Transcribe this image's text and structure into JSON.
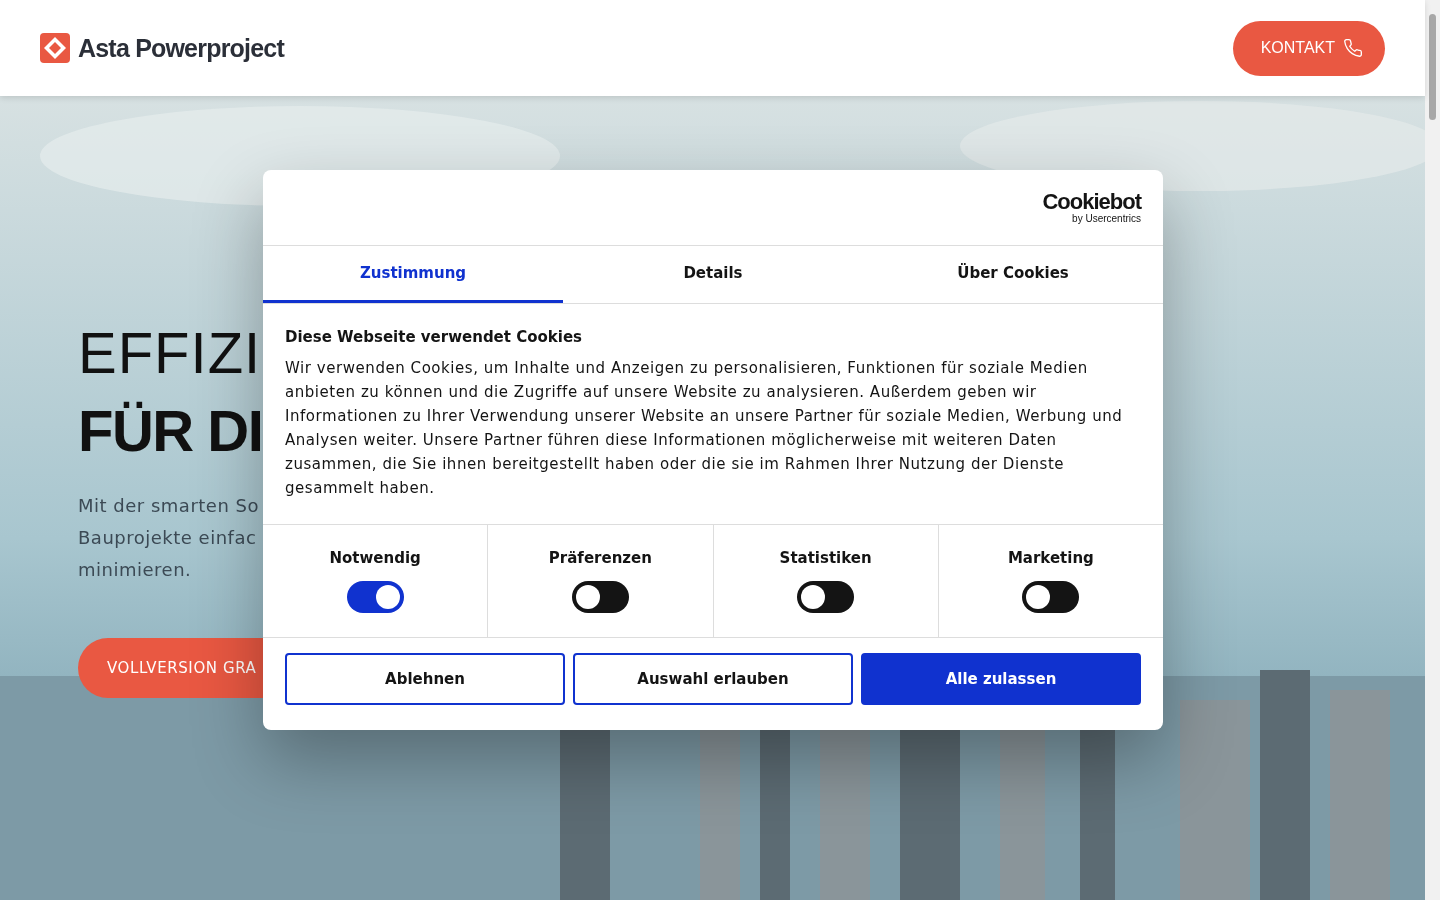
{
  "header": {
    "logo": "Asta Powerproject",
    "contact_button": "KONTAKT"
  },
  "hero": {
    "title_lines": [
      "EFFIZI",
      "FÜR DI"
    ],
    "text_lines": [
      "Mit der smarten So",
      "Bauprojekte einfac",
      "minimieren."
    ],
    "cta": "VOLLVERSION GRA"
  },
  "cookie_dialog": {
    "brand": "Cookiebot",
    "brand_sub": "by Usercentrics",
    "tabs": [
      {
        "label": "Zustimmung",
        "selected": true
      },
      {
        "label": "Details",
        "selected": false
      },
      {
        "label": "Über Cookies",
        "selected": false
      }
    ],
    "heading": "Diese Webseite verwendet Cookies",
    "body": "Wir verwenden Cookies, um Inhalte und Anzeigen zu personalisieren, Funktionen für soziale Medien anbieten zu können und die Zugriffe auf unsere Website zu analysieren. Außerdem geben wir Informationen zu Ihrer Verwendung unserer Website an unsere Partner für soziale Medien, Werbung und Analysen weiter. Unsere Partner führen diese Informationen möglicherweise mit weiteren Daten zusammen, die Sie ihnen bereitgestellt haben oder die sie im Rahmen Ihrer Nutzung der Dienste gesammelt haben.",
    "categories": [
      {
        "label": "Notwendig",
        "on": true
      },
      {
        "label": "Präferenzen",
        "on": false
      },
      {
        "label": "Statistiken",
        "on": false
      },
      {
        "label": "Marketing",
        "on": false
      }
    ],
    "buttons": [
      {
        "label": "Ablehnen",
        "kind": "outline"
      },
      {
        "label": "Auswahl erlauben",
        "kind": "outline"
      },
      {
        "label": "Alle zulassen",
        "kind": "primary"
      }
    ]
  }
}
